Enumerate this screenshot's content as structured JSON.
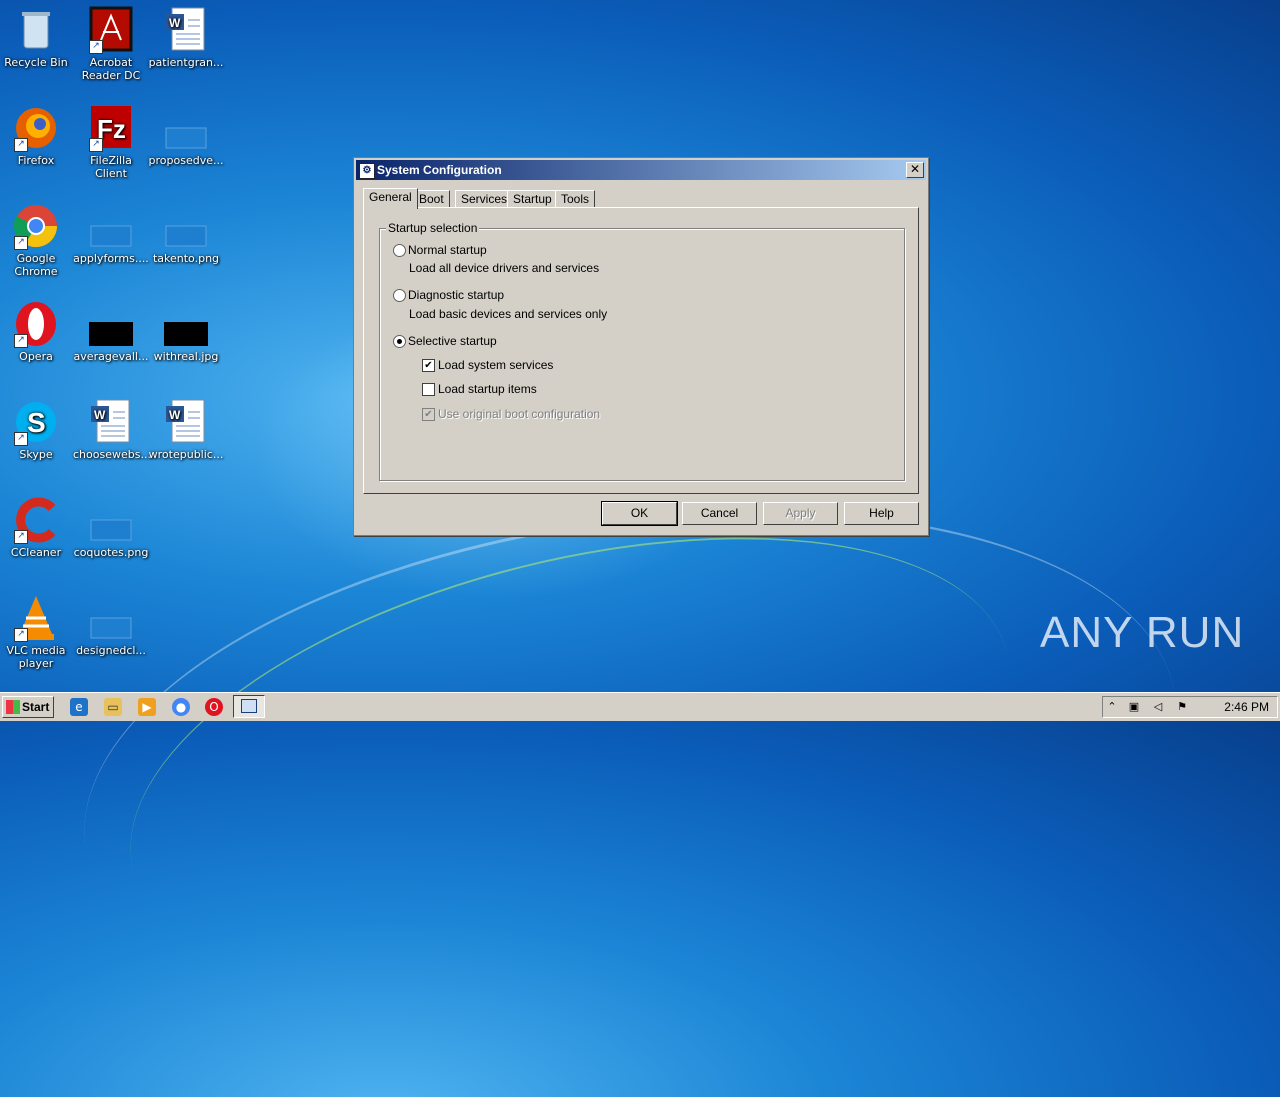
{
  "desktop": {
    "icons": [
      {
        "label": "Recycle Bin",
        "icon": "recycle-bin-icon"
      },
      {
        "label": "Acrobat Reader DC",
        "icon": "acrobat-icon"
      },
      {
        "label": "patientgran...",
        "icon": "word-doc-icon"
      },
      {
        "label": "Firefox",
        "icon": "firefox-icon"
      },
      {
        "label": "FileZilla Client",
        "icon": "filezilla-icon"
      },
      {
        "label": "proposedve...",
        "icon": "image-file-icon"
      },
      {
        "label": "Google Chrome",
        "icon": "chrome-icon"
      },
      {
        "label": "applyforms....",
        "icon": "image-file-icon"
      },
      {
        "label": "takento.png",
        "icon": "image-file-icon"
      },
      {
        "label": "Opera",
        "icon": "opera-icon"
      },
      {
        "label": "averagevall...",
        "icon": "image-file-icon"
      },
      {
        "label": "withreal.jpg",
        "icon": "image-file-icon"
      },
      {
        "label": "Skype",
        "icon": "skype-icon"
      },
      {
        "label": "choosewebs...",
        "icon": "word-doc-icon"
      },
      {
        "label": "wrotepublic...",
        "icon": "word-doc-icon"
      },
      {
        "label": "CCleaner",
        "icon": "ccleaner-icon"
      },
      {
        "label": "coquotes.png",
        "icon": "image-file-icon"
      },
      {
        "label": "VLC media player",
        "icon": "vlc-icon"
      },
      {
        "label": "designedcl...",
        "icon": "image-file-icon"
      }
    ]
  },
  "dialog": {
    "title": "System Configuration",
    "tabs": [
      "General",
      "Boot",
      "Services",
      "Startup",
      "Tools"
    ],
    "active_tab": "General",
    "group_title": "Startup selection",
    "options": [
      {
        "label": "Normal startup",
        "description": "Load all device drivers and services",
        "selected": false
      },
      {
        "label": "Diagnostic startup",
        "description": "Load basic devices and services only",
        "selected": false
      },
      {
        "label": "Selective startup",
        "selected": true
      }
    ],
    "checkboxes": [
      {
        "label": "Load system services",
        "checked": true,
        "enabled": true
      },
      {
        "label": "Load startup items",
        "checked": false,
        "enabled": true
      },
      {
        "label": "Use original boot configuration",
        "checked": true,
        "enabled": false
      }
    ],
    "buttons": {
      "ok": "OK",
      "cancel": "Cancel",
      "apply": "Apply",
      "help": "Help"
    }
  },
  "taskbar": {
    "start_label": "Start",
    "clock": "2:46 PM"
  },
  "watermark": "ANY RUN"
}
